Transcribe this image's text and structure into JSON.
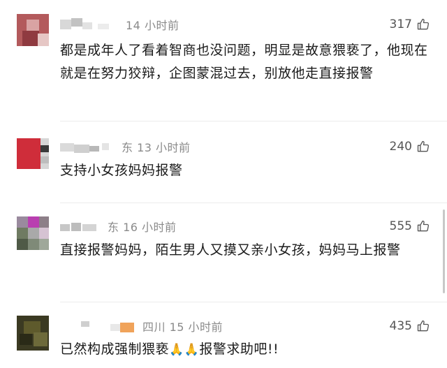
{
  "comments": [
    {
      "meta": "14 小时前",
      "likes": "317",
      "text": "都是成年人了看着智商也没问题，明显是故意猥亵了，他现在就是在努力狡辩，企图蒙混过去，别放他走直接报警"
    },
    {
      "meta": "东 13 小时前",
      "likes": "240",
      "text": "支持小女孩妈妈报警"
    },
    {
      "meta": "东 16 小时前",
      "likes": "555",
      "text": "直接报警妈妈，陌生男人又摸又亲小女孩，妈妈马上报警"
    },
    {
      "meta": "四川 15 小时前",
      "likes": "435",
      "text_before": "已然构成强制猥亵",
      "emoji": "🙏🙏",
      "text_after": "报警求助吧!!"
    }
  ],
  "icons": {
    "like": "thumbs-up-icon"
  },
  "colors": {
    "text": "#1a1a1a",
    "meta": "#8c8c8c",
    "divider": "#ececec"
  }
}
